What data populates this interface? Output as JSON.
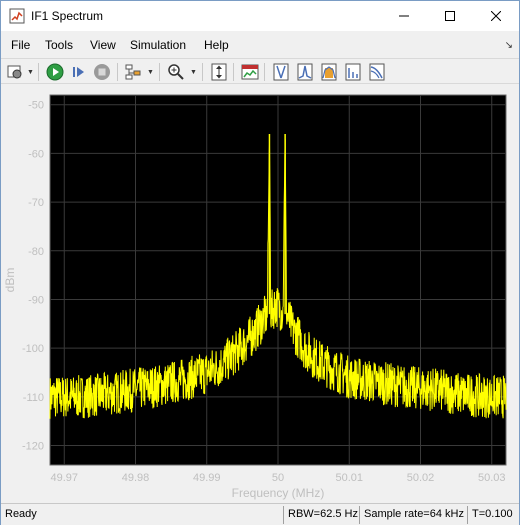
{
  "window": {
    "title": "IF1 Spectrum"
  },
  "menu": {
    "items": [
      "File",
      "Tools",
      "View",
      "Simulation",
      "Help"
    ]
  },
  "toolbar": {
    "icons": [
      "settings-icon",
      "run-icon",
      "step-forward-icon",
      "stop-icon",
      "measurements-icon",
      "zoom-in-icon",
      "autoscale-icon",
      "spectrum-settings-icon",
      "cursor-measurements-icon",
      "channel-measurements-icon",
      "distortion-measurements-icon",
      "ccdf-measurements-icon"
    ]
  },
  "status": {
    "ready": "Ready",
    "rbw": "RBW=62.5 Hz",
    "sample_rate": "Sample rate=64 kHz",
    "time": "T=0.100"
  },
  "colors": {
    "plot_bg": "#000000",
    "trace": "#ffff00",
    "axes_text": "#bfbfbf",
    "grid": "#3a3a3a"
  },
  "chart_data": {
    "type": "line",
    "title": "",
    "xlabel": "Frequency (MHz)",
    "ylabel": "dBm",
    "xlim": [
      49.968,
      50.032
    ],
    "ylim": [
      -124,
      -48
    ],
    "xticks": [
      49.97,
      49.98,
      49.99,
      50,
      50.01,
      50.02,
      50.03
    ],
    "xtick_labels": [
      "49.97",
      "49.98",
      "49.99",
      "50",
      "50.01",
      "50.02",
      "50.03"
    ],
    "yticks": [
      -50,
      -60,
      -70,
      -80,
      -90,
      -100,
      -110,
      -120
    ],
    "ytick_labels": [
      "-50",
      "-60",
      "-70",
      "-80",
      "-90",
      "-100",
      "-110",
      "-120"
    ],
    "grid": true,
    "series": [
      {
        "x": [
          49.968,
          49.972,
          49.976,
          49.98,
          49.984,
          49.988,
          49.99,
          49.992,
          49.994,
          49.996,
          49.997,
          49.998,
          49.9985,
          49.9988,
          49.999,
          49.9993,
          49.9996,
          50,
          50.0004,
          50.0007,
          50.001,
          50.0012,
          50.0015,
          50.002,
          50.003,
          50.004,
          50.006,
          50.008,
          50.01,
          50.014,
          50.018,
          50.022,
          50.026,
          50.03,
          50.032
        ],
        "y": [
          -110,
          -110,
          -109.5,
          -108.5,
          -107.5,
          -106,
          -105,
          -103.5,
          -101,
          -98,
          -96,
          -94,
          -93,
          -56,
          -93,
          -92,
          -91,
          -91.5,
          -92,
          -93,
          -56,
          -93,
          -94,
          -96,
          -98,
          -100.5,
          -103,
          -104.5,
          -106,
          -107,
          -108,
          -108.5,
          -109.5,
          -110,
          -110
        ]
      }
    ]
  }
}
